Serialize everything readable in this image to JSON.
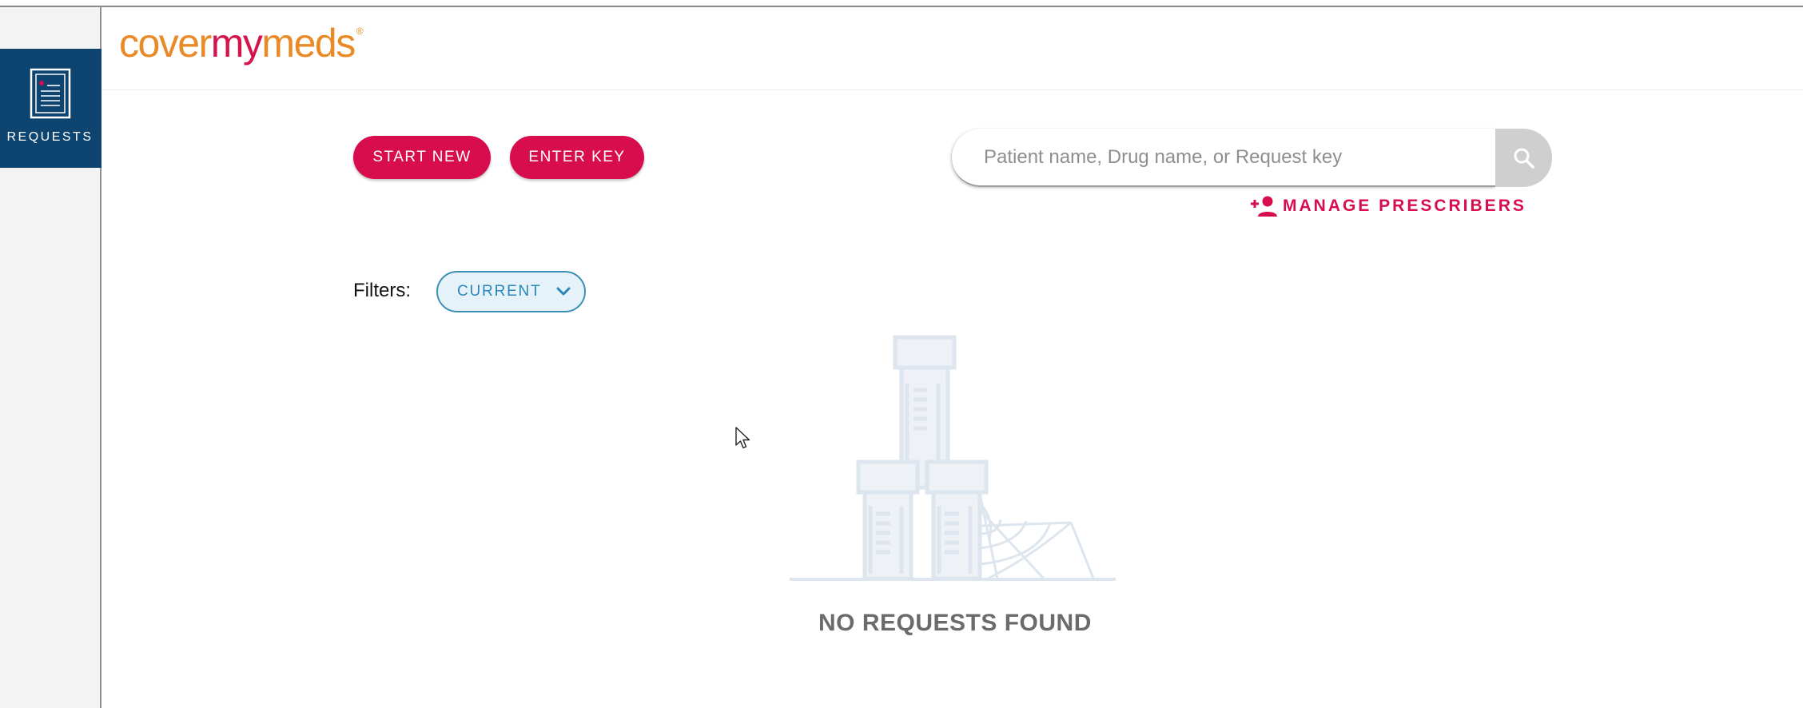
{
  "sidebar": {
    "items": [
      {
        "label": "REQUESTS",
        "icon": "document-icon"
      }
    ]
  },
  "header": {
    "logo": {
      "part1": "cover",
      "part2": "my",
      "part3": "meds",
      "reg": "®"
    }
  },
  "toolbar": {
    "start_new_label": "START NEW",
    "enter_key_label": "ENTER KEY"
  },
  "search": {
    "placeholder": "Patient name, Drug name, or Request key",
    "value": "",
    "button_icon": "search-icon"
  },
  "manage_prescribers": {
    "label": "MANAGE PRESCRIBERS",
    "icon": "add-person-icon"
  },
  "filters": {
    "label": "Filters:",
    "selected": "CURRENT"
  },
  "empty_state": {
    "message": "NO REQUESTS FOUND"
  },
  "colors": {
    "brand_pink": "#d70d4e",
    "brand_orange": "#e98a26",
    "sidebar_active": "#0d4470",
    "filter_blue": "#2a86b8"
  }
}
